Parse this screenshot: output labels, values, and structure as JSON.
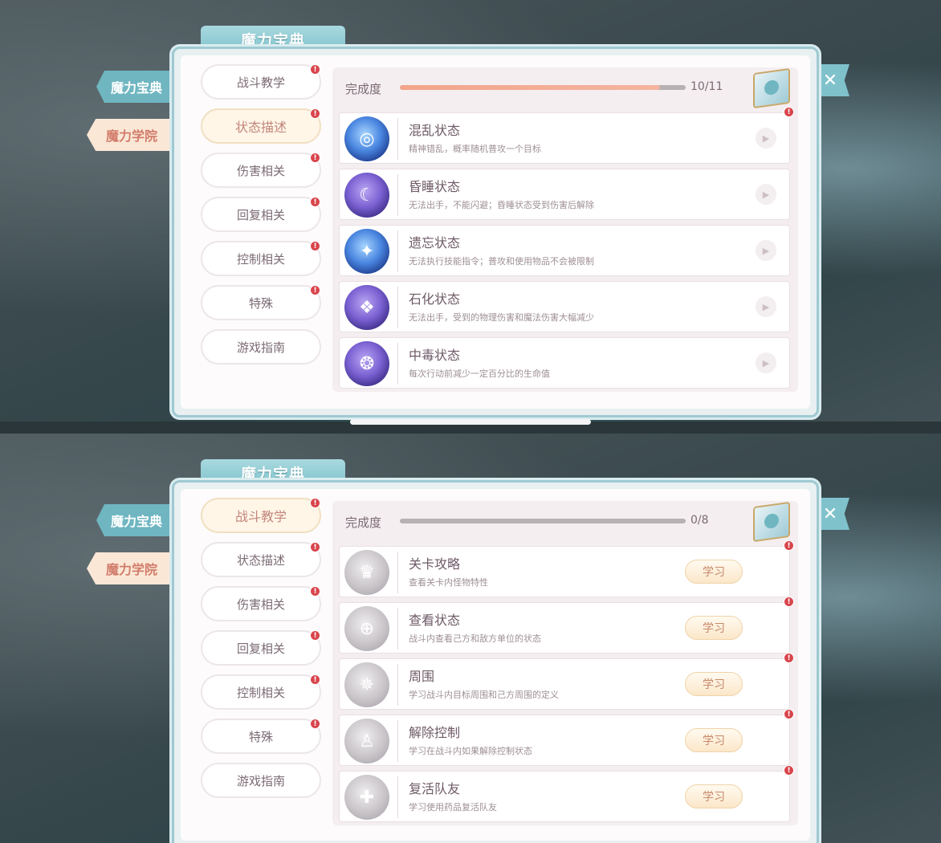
{
  "top": {
    "title": "魔力宝典",
    "side_tabs": [
      "魔力宝典",
      "魔力学院"
    ],
    "categories": [
      "战斗教学",
      "状态描述",
      "伤害相关",
      "回复相关",
      "控制相关",
      "特殊",
      "游戏指南"
    ],
    "active_category": "状态描述",
    "progress": {
      "label": "完成度",
      "count": "10/11",
      "fraction": 0.91
    },
    "items": [
      {
        "name": "混乱状态",
        "desc": "精神错乱，概率随机普攻一个目标",
        "icon": "swirl-icon"
      },
      {
        "name": "昏睡状态",
        "desc": "无法出手，不能闪避；昏睡状态受到伤害后解除",
        "icon": "sleep-icon"
      },
      {
        "name": "遗忘状态",
        "desc": "无法执行技能指令；普攻和使用物品不会被限制",
        "icon": "forget-icon"
      },
      {
        "name": "石化状态",
        "desc": "无法出手，受到的物理伤害和魔法伤害大幅减少",
        "icon": "stone-icon"
      },
      {
        "name": "中毒状态",
        "desc": "每次行动前减少一定百分比的生命值",
        "icon": "poison-icon"
      }
    ],
    "close": "✕"
  },
  "bottom": {
    "title": "魔力宝典",
    "side_tabs": [
      "魔力宝典",
      "魔力学院"
    ],
    "categories": [
      "战斗教学",
      "状态描述",
      "伤害相关",
      "回复相关",
      "控制相关",
      "特殊",
      "游戏指南"
    ],
    "active_category": "战斗教学",
    "progress": {
      "label": "完成度",
      "count": "0/8",
      "fraction": 0
    },
    "learn_label": "学习",
    "items": [
      {
        "name": "关卡攻略",
        "desc": "查看关卡内怪物特性",
        "icon": "mask-icon"
      },
      {
        "name": "查看状态",
        "desc": "战斗内查看己方和敌方单位的状态",
        "icon": "target-icon"
      },
      {
        "name": "周围",
        "desc": "学习战斗内目标周围和己方周围的定义",
        "icon": "star-icon"
      },
      {
        "name": "解除控制",
        "desc": "学习在战斗内如果解除控制状态",
        "icon": "release-icon"
      },
      {
        "name": "复活队友",
        "desc": "学习使用药品复活队友",
        "icon": "revive-icon"
      }
    ],
    "close": "✕"
  },
  "badge": "!",
  "colors": {
    "accent": "#7fc2cc",
    "badge": "#d9454c",
    "progress": "#f2a58a"
  }
}
